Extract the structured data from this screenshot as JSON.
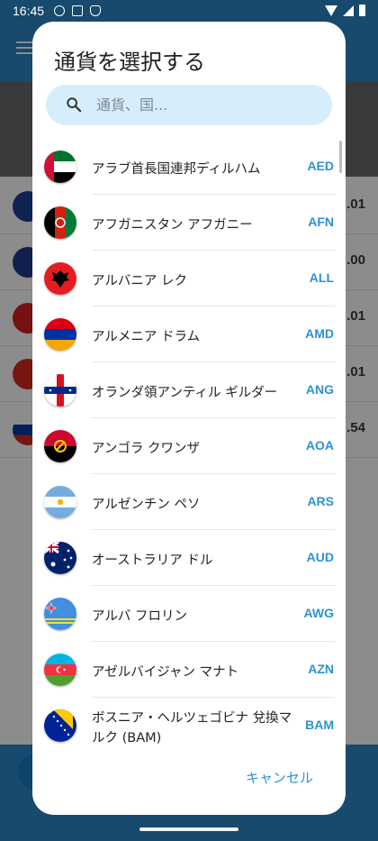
{
  "status_bar": {
    "time": "16:45"
  },
  "background": {
    "amounts": [
      ".01",
      ".00",
      ".01",
      ".01",
      ".54"
    ]
  },
  "dialog": {
    "title": "通貨を選択する",
    "search_placeholder": "通貨、国...",
    "cancel_label": "キャンセル",
    "currencies": [
      {
        "name": "アラブ首長国連邦ディルハム",
        "code": "AED",
        "flag": "uae"
      },
      {
        "name": "アフガニスタン アフガニー",
        "code": "AFN",
        "flag": "afghanistan"
      },
      {
        "name": "アルバニア レク",
        "code": "ALL",
        "flag": "albania"
      },
      {
        "name": "アルメニア ドラム",
        "code": "AMD",
        "flag": "armenia"
      },
      {
        "name": "オランダ領アンティル ギルダー",
        "code": "ANG",
        "flag": "netherlands-antilles"
      },
      {
        "name": "アンゴラ クワンザ",
        "code": "AOA",
        "flag": "angola"
      },
      {
        "name": "アルゼンチン ペソ",
        "code": "ARS",
        "flag": "argentina"
      },
      {
        "name": "オーストラリア ドル",
        "code": "AUD",
        "flag": "australia"
      },
      {
        "name": "アルバ フロリン",
        "code": "AWG",
        "flag": "aruba"
      },
      {
        "name": "アゼルバイジャン マナト",
        "code": "AZN",
        "flag": "azerbaijan"
      },
      {
        "name": "ボスニア・ヘルツェゴビナ 兌換マルク (BAM)",
        "code": "BAM",
        "flag": "bosnia"
      }
    ]
  },
  "colors": {
    "accent": "#2a93d5",
    "primary": "#2a88c7",
    "search_bg": "#d6eefc"
  }
}
